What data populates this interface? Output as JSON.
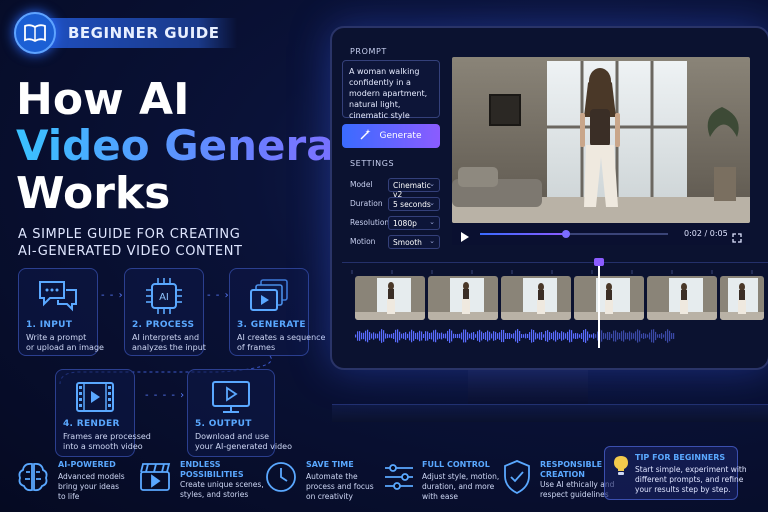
{
  "badge": {
    "label": "BEGINNER GUIDE",
    "icon": "open-book-icon"
  },
  "title": {
    "line1": "How AI",
    "line2": "Video Generation",
    "line3": "Works"
  },
  "subtitle": {
    "line1": "A SIMPLE GUIDE FOR CREATING",
    "line2": "AI-GENERATED VIDEO CONTENT"
  },
  "steps": [
    {
      "title": "1.  INPUT",
      "desc1": "Write a prompt",
      "desc2": "or upload an image",
      "icon": "chat-bubbles-icon"
    },
    {
      "title": "2.  PROCESS",
      "desc1": "AI interprets and",
      "desc2": "analyzes the input",
      "icon": "ai-chip-icon",
      "chip_text": "AI"
    },
    {
      "title": "3.  GENERATE",
      "desc1": "AI creates a sequence",
      "desc2": "of frames",
      "icon": "frames-stack-icon"
    },
    {
      "title": "4.  RENDER",
      "desc1": "Frames are processed",
      "desc2": "into a smooth video",
      "icon": "film-strip-icon"
    },
    {
      "title": "5.  OUTPUT",
      "desc1": "Download and use",
      "desc2": "your AI-generated video",
      "icon": "monitor-play-icon"
    }
  ],
  "editor": {
    "prompt_label": "PROMPT",
    "prompt_text": "A woman walking confidently in a modern apartment, natural light, cinematic style",
    "generate_label": "Generate",
    "settings_label": "SETTINGS",
    "settings": [
      {
        "label": "Model",
        "value": "Cinematic v2"
      },
      {
        "label": "Duration",
        "value": "5 seconds"
      },
      {
        "label": "Resolution",
        "value": "1080p"
      },
      {
        "label": "Motion",
        "value": "Smooth"
      }
    ],
    "time": "0:02 / 0:05",
    "progress": 0.46,
    "playhead": 0.6
  },
  "features": [
    {
      "title1": "AI-POWERED",
      "title2": "",
      "desc": [
        "Advanced models",
        "bring your ideas",
        "to life"
      ],
      "icon": "brain-icon"
    },
    {
      "title1": "ENDLESS",
      "title2": "POSSIBILITIES",
      "desc": [
        "Create unique scenes,",
        "styles, and stories"
      ],
      "icon": "clapperboard-icon"
    },
    {
      "title1": "SAVE TIME",
      "title2": "",
      "desc": [
        "Automate the",
        "process and focus",
        "on creativity"
      ],
      "icon": "clock-icon"
    },
    {
      "title1": "FULL CONTROL",
      "title2": "",
      "desc": [
        "Adjust style, motion,",
        "duration, and more",
        "with ease"
      ],
      "icon": "sliders-icon"
    },
    {
      "title1": "RESPONSIBLE",
      "title2": "CREATION",
      "desc": [
        "Use AI ethically and",
        "respect guidelines"
      ],
      "icon": "shield-check-icon"
    }
  ],
  "tip": {
    "title": "TIP FOR BEGINNERS",
    "desc": [
      "Start simple, experiment with",
      "different prompts, and refine",
      "your results step by step."
    ],
    "icon": "lightbulb-icon"
  },
  "colors": {
    "accent_blue": "#5aa8ff",
    "accent_purple": "#8b5cff",
    "background": "#050a22"
  }
}
